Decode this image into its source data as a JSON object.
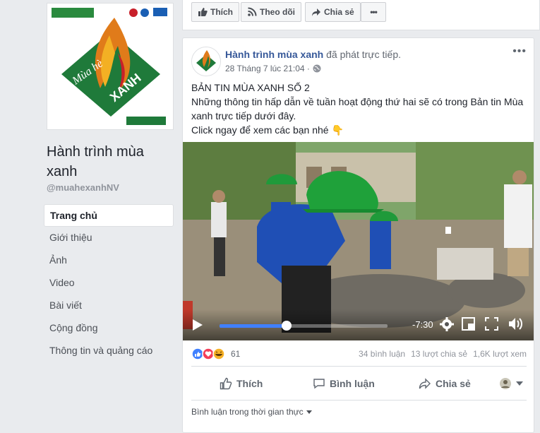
{
  "page": {
    "name": "Hành trình mùa xanh",
    "handle": "@muahexanhNV"
  },
  "nav": {
    "items": [
      "Trang chủ",
      "Giới thiệu",
      "Ảnh",
      "Video",
      "Bài viết",
      "Cộng đồng",
      "Thông tin và quảng cáo"
    ],
    "active": "Trang chủ"
  },
  "topbar": {
    "like_label": "Thích",
    "follow_label": "Theo dõi",
    "share_label": "Chia sẻ",
    "more_label": "•••"
  },
  "post": {
    "author": "Hành trình mùa xanh",
    "action_text": "đã phát trực tiếp.",
    "timestamp": "28 Tháng 7 lúc 21:04 ·",
    "text_line1": "BẢN TIN MÙA XANH SỐ 2",
    "text_line2": "Những thông tin hấp dẫn về tuần hoạt động thứ hai sẽ có trong Bản tin Mùa xanh trực tiếp dưới đây.",
    "text_line3": "Click ngay để xem các bạn nhé 👇",
    "more_label": "•••"
  },
  "video": {
    "time_remaining": "-7:30",
    "progress": 0.4
  },
  "stats": {
    "reaction_count": "61",
    "comments": "34 bình luận",
    "shares": "13 lượt chia sẻ",
    "views": "1,6K lượt xem"
  },
  "actions": {
    "like": "Thích",
    "comment": "Bình luận",
    "share": "Chia sẻ"
  },
  "comments_filter": "Bình luận trong thời gian thực",
  "colors": {
    "link": "#365899",
    "accent_green": "#1f8a3a",
    "accent_orange": "#e07b1a"
  }
}
